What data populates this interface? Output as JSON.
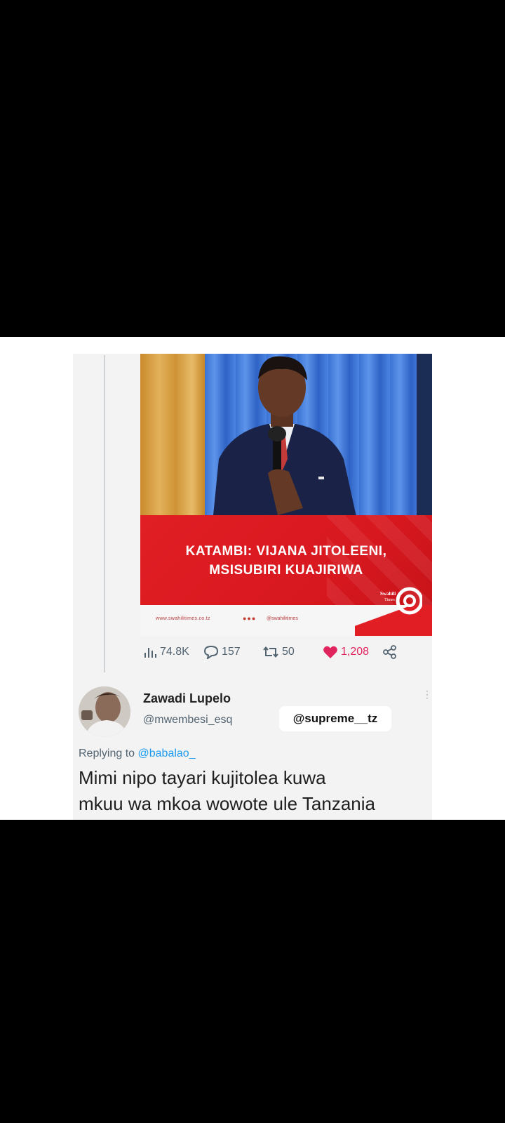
{
  "media": {
    "headline_line1": "KATAMBI: VIJANA JITOLEENI,",
    "headline_line2": "MSISUBIRI KUAJIRIWA",
    "brand_logo": "Swahili Times",
    "footer_url": "www.swahilitimes.co.tz",
    "footer_handle": "@swahilitimes"
  },
  "stats": {
    "views": "74.8K",
    "replies": "157",
    "retweets": "50",
    "likes": "1,208"
  },
  "reply": {
    "display_name": "Zawadi Lupelo",
    "handle": "@mwembesi_esq",
    "replying_prefix": "Replying to",
    "replying_to": "@babalao_",
    "text_line1": "Mimi nipo tayari kujitolea kuwa",
    "text_line2": "mkuu wa mkoa wowote ule Tanzania"
  },
  "watermark": "@supreme__tz",
  "colors": {
    "banner_red": "#e01e24",
    "like_pink": "#e0245e",
    "link_blue": "#1d9bf0",
    "muted_gray": "#536471"
  },
  "icons": [
    "views-icon",
    "reply-icon",
    "retweet-icon",
    "heart-icon",
    "share-icon",
    "more-icon"
  ]
}
